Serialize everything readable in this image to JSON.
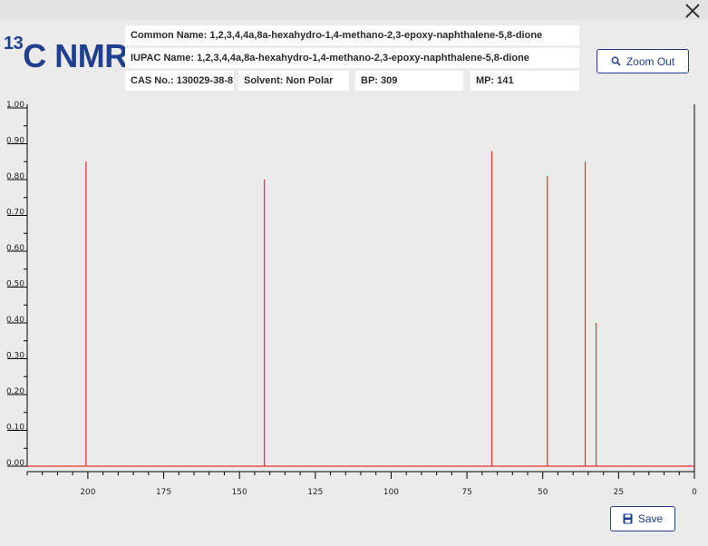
{
  "header": {
    "title_sup": "13",
    "title_main": "C NMR",
    "common_name": "Common Name: 1,2,3,4,4a,8a-hexahydro-1,4-methano-2,3-epoxy-naphthalene-5,8-dione",
    "iupac_name": "IUPAC Name: 1,2,3,4,4a,8a-hexahydro-1,4-methano-2,3-epoxy-naphthalene-5,8-dione",
    "cas": "CAS No.: 130029-38-8",
    "solvent": "Solvent: Non Polar",
    "bp": "BP: 309",
    "mp": "MP: 141"
  },
  "buttons": {
    "zoom_out": "Zoom Out",
    "save": "Save",
    "zoom_icon": "magnifier-icon",
    "save_icon": "floppy-disk-icon",
    "close_icon": "close-icon"
  },
  "colors": {
    "accent": "#1f3f8f",
    "peak": "#e8302a"
  },
  "chart_data": {
    "type": "bar",
    "x_axis": {
      "reversed": true,
      "min": 0,
      "max": 220,
      "ticks": [
        200,
        175,
        150,
        125,
        100,
        75,
        50,
        25,
        0
      ],
      "tick_labels": [
        "200",
        "175",
        "150",
        "125",
        "100",
        "75",
        "50",
        "25",
        "0"
      ]
    },
    "y_axis": {
      "min": 0,
      "max": 1.0,
      "ticks": [
        0,
        0.1,
        0.2,
        0.3,
        0.4,
        0.5,
        0.6,
        0.7,
        0.8,
        0.9,
        1.0
      ],
      "tick_labels": [
        "0.00",
        "0.10",
        "0.20",
        "0.30",
        "0.40",
        "0.50",
        "0.60",
        "0.70",
        "0.80",
        "0.90",
        "1.00"
      ]
    },
    "peaks": [
      {
        "shift": 200.6,
        "intensity": 0.85
      },
      {
        "shift": 141.8,
        "intensity": 0.8
      },
      {
        "shift": 66.8,
        "intensity": 0.88
      },
      {
        "shift": 48.5,
        "intensity": 0.81
      },
      {
        "shift": 36.0,
        "intensity": 0.85
      },
      {
        "shift": 32.4,
        "intensity": 0.4
      }
    ],
    "grid": false
  }
}
